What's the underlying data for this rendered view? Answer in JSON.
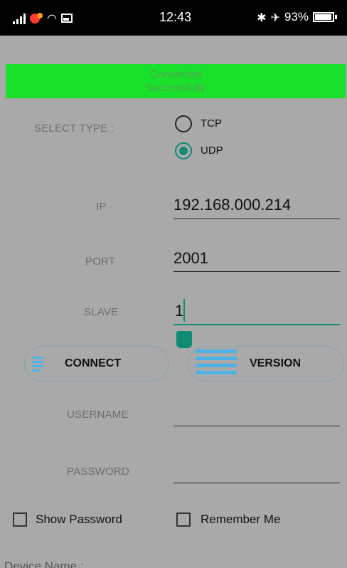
{
  "status_bar": {
    "time": "12:43",
    "battery": "93%",
    "icons": [
      "signal-icon",
      "notification-icon",
      "wifi-icon",
      "image-icon",
      "bluetooth-icon",
      "mute-icon",
      "battery-icon"
    ]
  },
  "banner": {
    "line1": "Connected",
    "line2": "Successfully",
    "color": "#19e02a"
  },
  "select_type": {
    "label": "SELECT TYPE :",
    "options": [
      {
        "label": "TCP",
        "selected": false
      },
      {
        "label": "UDP",
        "selected": true
      }
    ]
  },
  "fields": {
    "ip": {
      "label": "IP",
      "value": "192.168.000.214"
    },
    "port": {
      "label": "PORT",
      "value": "2001"
    },
    "slave": {
      "label": "SLAVE",
      "value": "1"
    },
    "username": {
      "label": "USERNAME",
      "value": ""
    },
    "password": {
      "label": "PASSWORD",
      "value": ""
    }
  },
  "buttons": {
    "connect": "CONNECT",
    "version": "VERSION"
  },
  "checkboxes": {
    "show_password": "Show Password",
    "remember_me": "Remember Me"
  },
  "footer": {
    "device_name_label": "Device Name :"
  },
  "colors": {
    "accent": "#0f8a73",
    "background": "#a9a9a9",
    "button_icon": "#4fb2e6"
  }
}
